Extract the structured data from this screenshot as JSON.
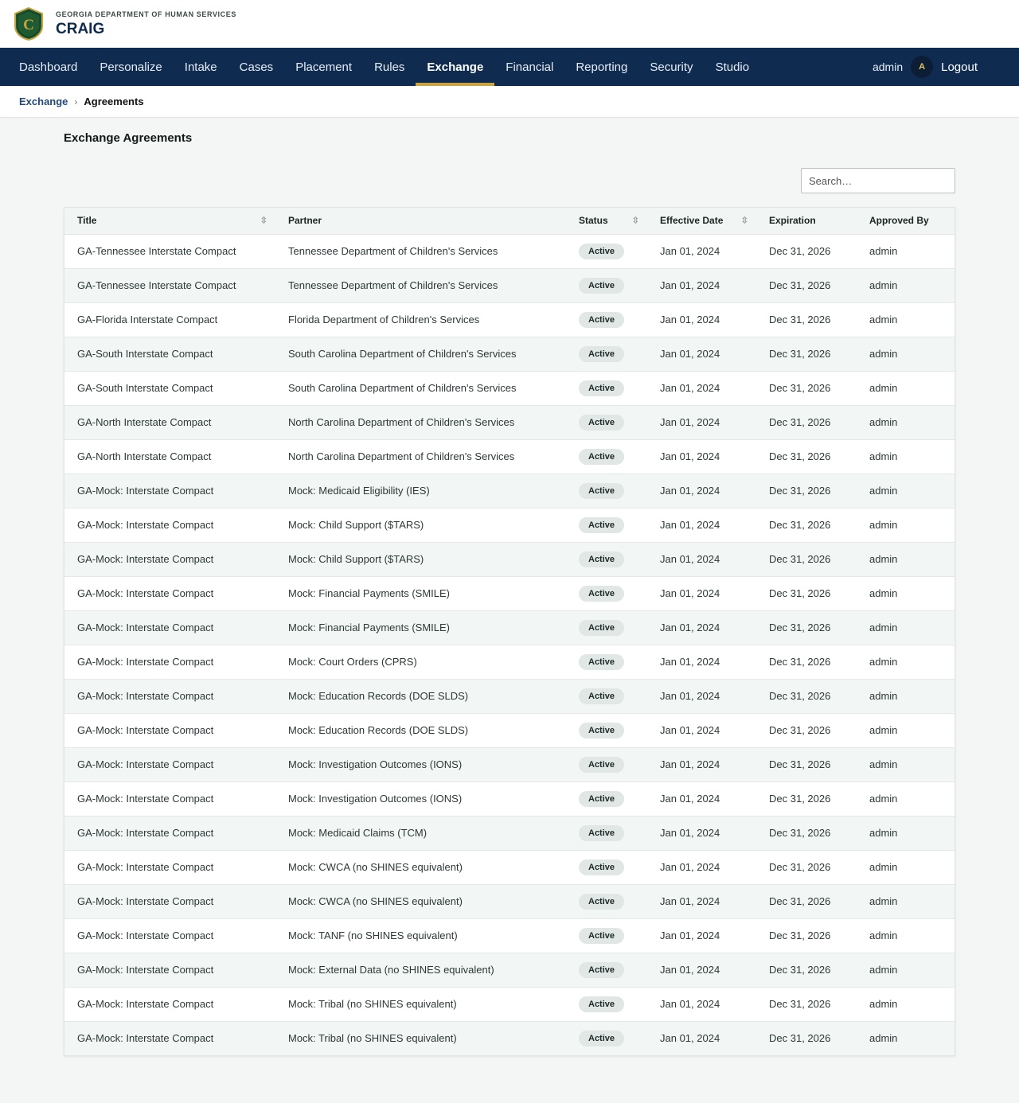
{
  "header": {
    "department": "GEORGIA DEPARTMENT OF HUMAN SERVICES",
    "app_name": "CRAIG",
    "logo_letter": "C"
  },
  "nav": {
    "items": [
      "Dashboard",
      "Personalize",
      "Intake",
      "Cases",
      "Placement",
      "Rules",
      "Exchange",
      "Financial",
      "Reporting",
      "Security",
      "Studio"
    ],
    "active": "Exchange",
    "username": "admin",
    "avatar_initial": "A",
    "logout_label": "Logout"
  },
  "breadcrumb": {
    "parent": "Exchange",
    "separator": "›",
    "current": "Agreements"
  },
  "page": {
    "title": "Exchange Agreements",
    "search_placeholder": "Search…"
  },
  "table": {
    "columns": [
      {
        "label": "Title",
        "sortable": true
      },
      {
        "label": "Partner",
        "sortable": false
      },
      {
        "label": "Status",
        "sortable": true
      },
      {
        "label": "Effective Date",
        "sortable": true
      },
      {
        "label": "Expiration",
        "sortable": false
      },
      {
        "label": "Approved By",
        "sortable": false
      }
    ],
    "sort_icon": "⇳",
    "rows": [
      {
        "title": "GA-Tennessee Interstate Compact",
        "partner": "Tennessee Department of Children's Services",
        "status": "Active",
        "effective": "Jan 01, 2024",
        "expiration": "Dec 31, 2026",
        "approved_by": "admin"
      },
      {
        "title": "GA-Tennessee Interstate Compact",
        "partner": "Tennessee Department of Children's Services",
        "status": "Active",
        "effective": "Jan 01, 2024",
        "expiration": "Dec 31, 2026",
        "approved_by": "admin"
      },
      {
        "title": "GA-Florida Interstate Compact",
        "partner": "Florida Department of Children's Services",
        "status": "Active",
        "effective": "Jan 01, 2024",
        "expiration": "Dec 31, 2026",
        "approved_by": "admin"
      },
      {
        "title": "GA-South Interstate Compact",
        "partner": "South Carolina Department of Children's Services",
        "status": "Active",
        "effective": "Jan 01, 2024",
        "expiration": "Dec 31, 2026",
        "approved_by": "admin"
      },
      {
        "title": "GA-South Interstate Compact",
        "partner": "South Carolina Department of Children's Services",
        "status": "Active",
        "effective": "Jan 01, 2024",
        "expiration": "Dec 31, 2026",
        "approved_by": "admin"
      },
      {
        "title": "GA-North Interstate Compact",
        "partner": "North Carolina Department of Children's Services",
        "status": "Active",
        "effective": "Jan 01, 2024",
        "expiration": "Dec 31, 2026",
        "approved_by": "admin"
      },
      {
        "title": "GA-North Interstate Compact",
        "partner": "North Carolina Department of Children's Services",
        "status": "Active",
        "effective": "Jan 01, 2024",
        "expiration": "Dec 31, 2026",
        "approved_by": "admin"
      },
      {
        "title": "GA-Mock: Interstate Compact",
        "partner": "Mock: Medicaid Eligibility (IES)",
        "status": "Active",
        "effective": "Jan 01, 2024",
        "expiration": "Dec 31, 2026",
        "approved_by": "admin"
      },
      {
        "title": "GA-Mock: Interstate Compact",
        "partner": "Mock: Child Support ($TARS)",
        "status": "Active",
        "effective": "Jan 01, 2024",
        "expiration": "Dec 31, 2026",
        "approved_by": "admin"
      },
      {
        "title": "GA-Mock: Interstate Compact",
        "partner": "Mock: Child Support ($TARS)",
        "status": "Active",
        "effective": "Jan 01, 2024",
        "expiration": "Dec 31, 2026",
        "approved_by": "admin"
      },
      {
        "title": "GA-Mock: Interstate Compact",
        "partner": "Mock: Financial Payments (SMILE)",
        "status": "Active",
        "effective": "Jan 01, 2024",
        "expiration": "Dec 31, 2026",
        "approved_by": "admin"
      },
      {
        "title": "GA-Mock: Interstate Compact",
        "partner": "Mock: Financial Payments (SMILE)",
        "status": "Active",
        "effective": "Jan 01, 2024",
        "expiration": "Dec 31, 2026",
        "approved_by": "admin"
      },
      {
        "title": "GA-Mock: Interstate Compact",
        "partner": "Mock: Court Orders (CPRS)",
        "status": "Active",
        "effective": "Jan 01, 2024",
        "expiration": "Dec 31, 2026",
        "approved_by": "admin"
      },
      {
        "title": "GA-Mock: Interstate Compact",
        "partner": "Mock: Education Records (DOE SLDS)",
        "status": "Active",
        "effective": "Jan 01, 2024",
        "expiration": "Dec 31, 2026",
        "approved_by": "admin"
      },
      {
        "title": "GA-Mock: Interstate Compact",
        "partner": "Mock: Education Records (DOE SLDS)",
        "status": "Active",
        "effective": "Jan 01, 2024",
        "expiration": "Dec 31, 2026",
        "approved_by": "admin"
      },
      {
        "title": "GA-Mock: Interstate Compact",
        "partner": "Mock: Investigation Outcomes (IONS)",
        "status": "Active",
        "effective": "Jan 01, 2024",
        "expiration": "Dec 31, 2026",
        "approved_by": "admin"
      },
      {
        "title": "GA-Mock: Interstate Compact",
        "partner": "Mock: Investigation Outcomes (IONS)",
        "status": "Active",
        "effective": "Jan 01, 2024",
        "expiration": "Dec 31, 2026",
        "approved_by": "admin"
      },
      {
        "title": "GA-Mock: Interstate Compact",
        "partner": "Mock: Medicaid Claims (TCM)",
        "status": "Active",
        "effective": "Jan 01, 2024",
        "expiration": "Dec 31, 2026",
        "approved_by": "admin"
      },
      {
        "title": "GA-Mock: Interstate Compact",
        "partner": "Mock: CWCA (no SHINES equivalent)",
        "status": "Active",
        "effective": "Jan 01, 2024",
        "expiration": "Dec 31, 2026",
        "approved_by": "admin"
      },
      {
        "title": "GA-Mock: Interstate Compact",
        "partner": "Mock: CWCA (no SHINES equivalent)",
        "status": "Active",
        "effective": "Jan 01, 2024",
        "expiration": "Dec 31, 2026",
        "approved_by": "admin"
      },
      {
        "title": "GA-Mock: Interstate Compact",
        "partner": "Mock: TANF (no SHINES equivalent)",
        "status": "Active",
        "effective": "Jan 01, 2024",
        "expiration": "Dec 31, 2026",
        "approved_by": "admin"
      },
      {
        "title": "GA-Mock: Interstate Compact",
        "partner": "Mock: External Data (no SHINES equivalent)",
        "status": "Active",
        "effective": "Jan 01, 2024",
        "expiration": "Dec 31, 2026",
        "approved_by": "admin"
      },
      {
        "title": "GA-Mock: Interstate Compact",
        "partner": "Mock: Tribal (no SHINES equivalent)",
        "status": "Active",
        "effective": "Jan 01, 2024",
        "expiration": "Dec 31, 2026",
        "approved_by": "admin"
      },
      {
        "title": "GA-Mock: Interstate Compact",
        "partner": "Mock: Tribal (no SHINES equivalent)",
        "status": "Active",
        "effective": "Jan 01, 2024",
        "expiration": "Dec 31, 2026",
        "approved_by": "admin"
      }
    ]
  },
  "colors": {
    "nav_background": "#0f2c50",
    "nav_active_underline": "#c9a441",
    "logo_shield": "#1f5a32",
    "logo_border": "#c9a441"
  },
  "icons": {
    "logo": "shield-logo-icon",
    "sort": "sort-arrows-icon"
  }
}
